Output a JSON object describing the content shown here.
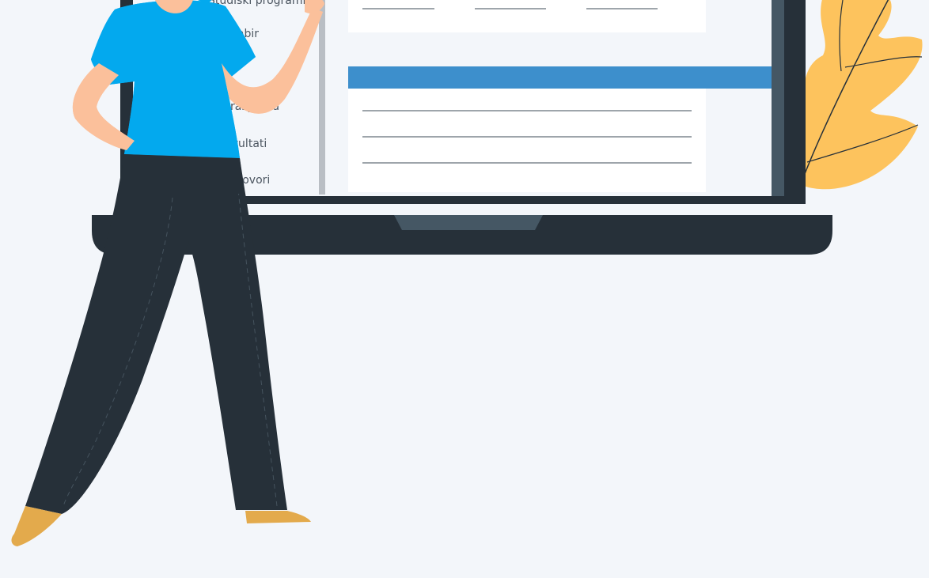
{
  "sidebar": {
    "items": [
      {
        "label": "Studiski programi"
      },
      {
        "label": "Odabir"
      },
      {
        "label": "Moj raspored"
      },
      {
        "label": "Rezultati"
      },
      {
        "label": "Razgovori"
      }
    ]
  },
  "colors": {
    "background": "#f3f6fa",
    "laptop": "#263039",
    "screen": "#ffffff",
    "accent_bar": "#3d8fcc",
    "leaf": "#fdc35d",
    "shirt": "#03a9ee",
    "skin": "#fbc09b",
    "shoes": "#e3aa4c"
  }
}
